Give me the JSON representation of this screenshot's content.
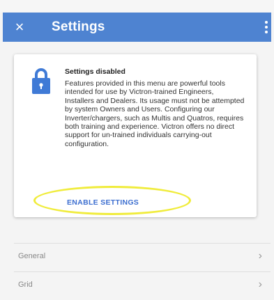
{
  "appbar": {
    "title": "Settings",
    "close_icon": "×",
    "more_icon": "more-vertical-icon"
  },
  "notice": {
    "title": "Settings disabled",
    "body": "Features provided in this menu are powerful tools intended for use by Victron-trained Engineers, Installers and Dealers. Its usage must not be attempted by system Owners and Users. Configuring our Inverter/chargers, such as Multis and Quatros, requires both training and experience. Victron offers no direct support for un-trained individuals carrying-out configuration.",
    "button_label": "ENABLE SETTINGS",
    "lock_icon": "lock-icon"
  },
  "menu": {
    "items": [
      {
        "label": "General",
        "chevron": "›"
      },
      {
        "label": "Grid",
        "chevron": "›"
      }
    ]
  },
  "colors": {
    "appbar": "#4e83d1",
    "accent": "#3d6fd0",
    "highlight": "#f0ec3c"
  }
}
